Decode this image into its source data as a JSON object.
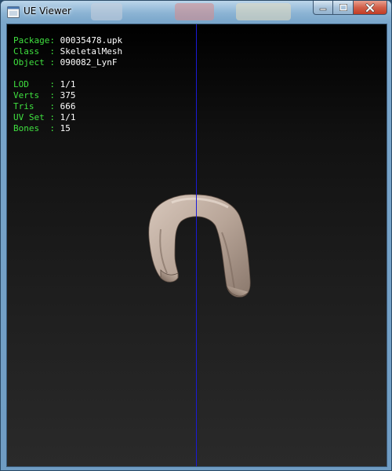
{
  "window": {
    "title": "UE Viewer",
    "app_icon": "ue-viewer-icon",
    "caption_buttons": {
      "minimize_icon": "minimize-icon",
      "maximize_icon": "maximize-icon",
      "close_icon": "close-icon"
    }
  },
  "info": {
    "package": {
      "label": "Package: ",
      "value": "00035478.upk"
    },
    "class": {
      "label": "Class  : ",
      "value": "SkeletalMesh"
    },
    "object": {
      "label": "Object : ",
      "value": "090082_LynF"
    },
    "lod": {
      "label": "LOD    : ",
      "value": "1/1"
    },
    "verts": {
      "label": "Verts  : ",
      "value": "375"
    },
    "tris": {
      "label": "Tris   : ",
      "value": "666"
    },
    "uvset": {
      "label": "UV Set : ",
      "value": "1/1"
    },
    "bones": {
      "label": "Bones  : ",
      "value": "15"
    }
  },
  "colors": {
    "label_green": "#3fe03f",
    "value_white": "#ffffff",
    "axis_line_blue": "#1a1ad6"
  }
}
